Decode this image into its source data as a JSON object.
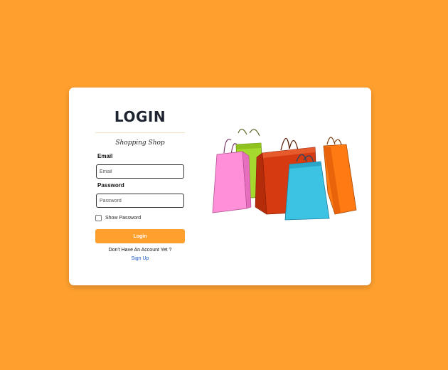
{
  "login": {
    "title": "LOGIN",
    "subtitle": "Shopping Shop",
    "email_label": "Email",
    "email_placeholder": "Email",
    "email_value": "",
    "password_label": "Password",
    "password_placeholder": "Password",
    "password_value": "",
    "show_password_label": "Show Password",
    "show_password_checked": false,
    "submit_label": "Login",
    "no_account_text": "Don't Have An Account Yet ?",
    "signup_link": "Sign Up"
  },
  "colors": {
    "background": "#FFA02E",
    "accent": "#FFA02E",
    "link": "#1a57c9",
    "card": "#ffffff"
  },
  "illustration": {
    "icon": "shopping-bags-illustration"
  }
}
